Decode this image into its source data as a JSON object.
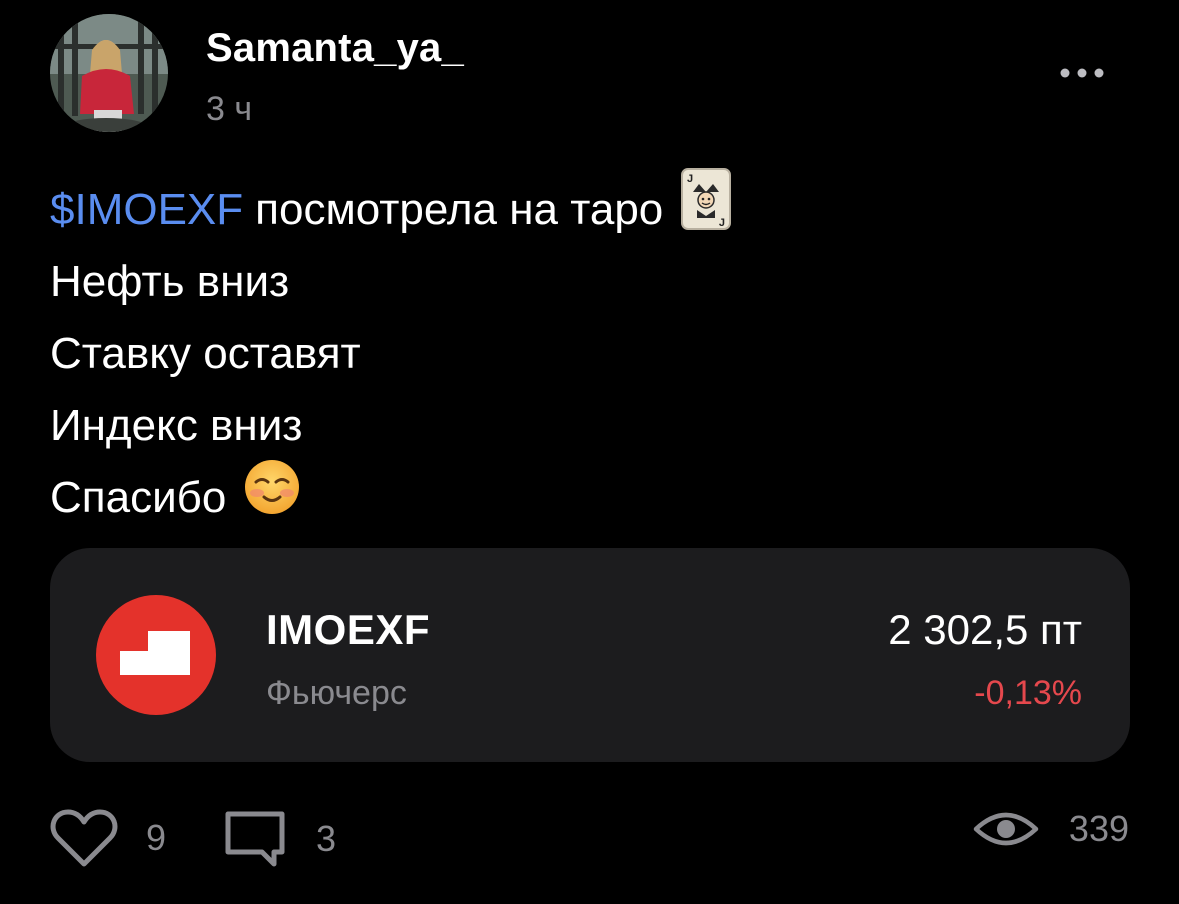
{
  "author": {
    "name": "Samanta_ya_",
    "time": "3 ч",
    "avatar_icon": "user-photo-avatar"
  },
  "post": {
    "ticker": "$IMOEXF",
    "line1_rest": "посмотрела на таро",
    "line1_emoji": "joker-card-icon",
    "line2": "Нефть вниз",
    "line3": "Ставку оставят",
    "line4": "Индекс вниз",
    "line5": "Спасибо",
    "line5_emoji": "smiling-face-icon"
  },
  "instrument_card": {
    "name": "IMOEXF",
    "type": "Фьючерс",
    "price": "2 302,5 пт",
    "change": "-0,13%",
    "change_color": "#e5484d",
    "logo_color": "#e4322b"
  },
  "actions": {
    "likes": "9",
    "comments": "3",
    "views": "339"
  },
  "colors": {
    "background": "#000000",
    "card_background": "#1c1c1e",
    "link": "#5a8df0",
    "muted": "#8a8a8f"
  }
}
